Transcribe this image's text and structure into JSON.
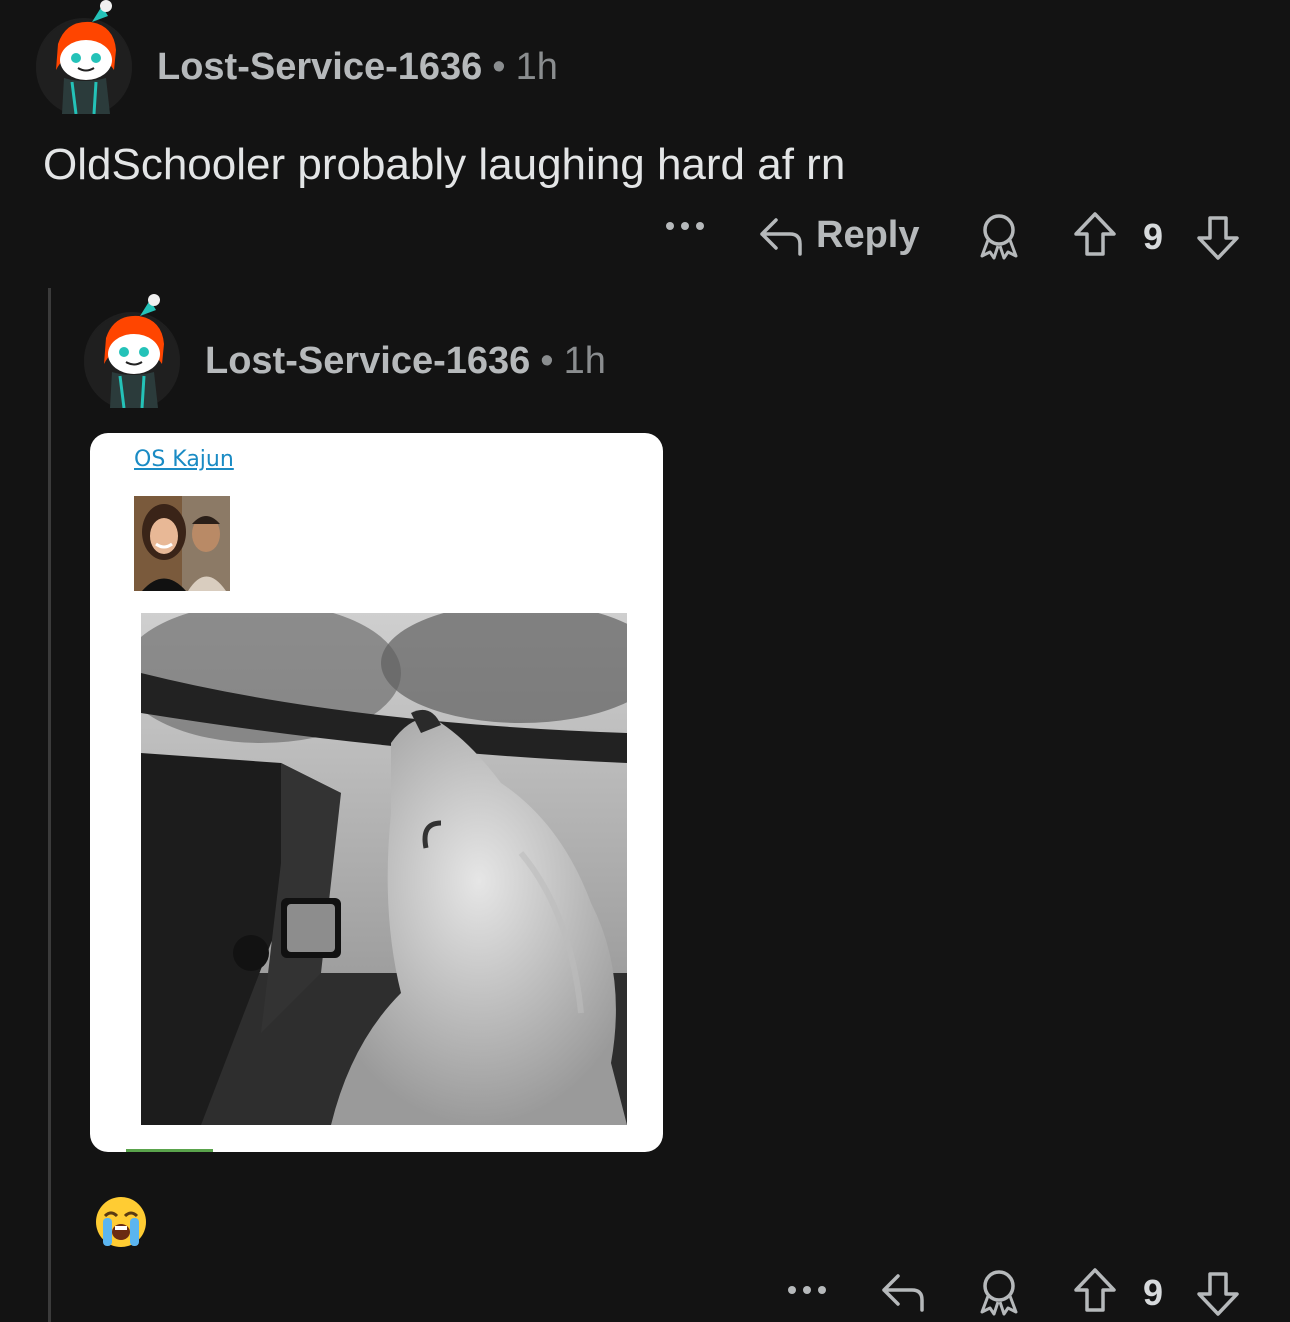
{
  "comment": {
    "author": "Lost-Service-1636",
    "separator": "•",
    "time": "1h",
    "text": "OldSchooler probably laughing hard af rn",
    "actions": {
      "more": "...",
      "reply_label": "Reply",
      "score": "9"
    }
  },
  "reply": {
    "author": "Lost-Service-1636",
    "separator": "•",
    "time": "1h",
    "embed": {
      "link_text": "OS Kajun"
    },
    "emoji": "loudly-crying-face",
    "actions": {
      "more": "...",
      "score": "9"
    }
  },
  "colors": {
    "background": "#131313",
    "avatar_orange": "#ff4500",
    "avatar_teal": "#24c2b8",
    "link": "#1a8bc4",
    "thread_line": "#3b3b3b"
  },
  "icons": [
    "snoo-avatar",
    "more-dots-icon",
    "reply-arrow-icon",
    "award-icon",
    "upvote-icon",
    "downvote-icon"
  ]
}
